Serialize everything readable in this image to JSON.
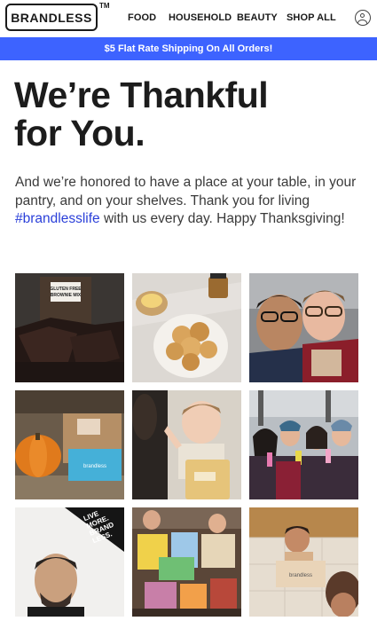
{
  "header": {
    "logo_text": "BRANDLESS",
    "trademark": "TM",
    "nav": [
      {
        "label": "FOOD"
      },
      {
        "label": "HOUSEHOLD"
      },
      {
        "label": "BEAUTY"
      },
      {
        "label": "SHOP ALL"
      }
    ],
    "account_icon": "user-circle-icon"
  },
  "promo": {
    "text": "$5 Flat Rate Shipping On All Orders!",
    "background": "#3d63ff"
  },
  "hero": {
    "title_line1": "We’re Thankful",
    "title_line2": "for You.",
    "intro_before": "And we’re honored to have a place at your table, in your pantry, and on your shelves. Thank you for living ",
    "hashtag": "#brandlesslife",
    "intro_after": " with us every day. Happy Thanksgiving!"
  },
  "photos": [
    {
      "subject": "brownies",
      "box_text_1": "GLUTEN FREE",
      "box_text_2": "BROWNIE MIX"
    },
    {
      "subject": "pancakes"
    },
    {
      "subject": "selfie-couple"
    },
    {
      "subject": "pumpkin-boxes",
      "box_label": "brandless"
    },
    {
      "subject": "baby-with-bag"
    },
    {
      "subject": "group-photo"
    },
    {
      "subject": "man-with-sign",
      "sign_line1": "LIVE",
      "sign_line2": "MORE.",
      "sign_line3": "BRAND",
      "sign_line4": "LESS."
    },
    {
      "subject": "kids-with-boxes"
    },
    {
      "subject": "toddler-with-box",
      "box_label": "brandless"
    }
  ]
}
